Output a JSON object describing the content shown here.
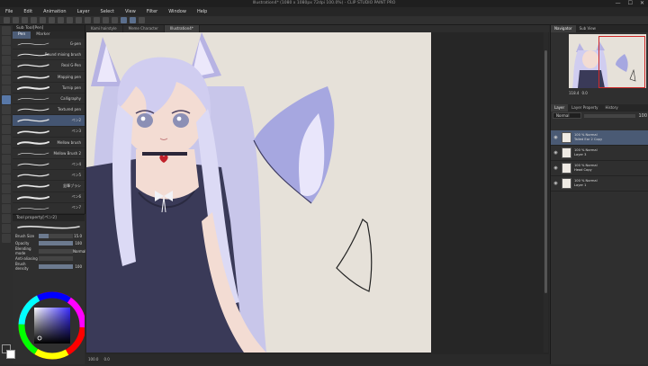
{
  "app": {
    "title": "Illustration4* (1080 x 1080px 72dpi 100.0%) - CLIP STUDIO PAINT PRO",
    "window_controls": [
      "—",
      "☐",
      "✕"
    ]
  },
  "menu": [
    "File",
    "Edit",
    "Animation",
    "Layer",
    "Select",
    "View",
    "Filter",
    "Window",
    "Help"
  ],
  "subtool": {
    "panel_title": "Sub Tool[Pen]",
    "tabs": [
      "Pen",
      "Marker"
    ],
    "brushes": [
      {
        "label": "G-pen"
      },
      {
        "label": "Round mixing brush"
      },
      {
        "label": "Real G-Pen"
      },
      {
        "label": "Mapping pen"
      },
      {
        "label": "Turnip pen"
      },
      {
        "label": "Calligraphy"
      },
      {
        "label": "Textured pen"
      },
      {
        "label": "ペン2"
      },
      {
        "label": "ペン3"
      },
      {
        "label": "Mellow brush"
      },
      {
        "label": "Mellow Brush 2"
      },
      {
        "label": "ペン4"
      },
      {
        "label": "ペン5"
      },
      {
        "label": "鉛筆ブラシ"
      },
      {
        "label": "ペン6"
      },
      {
        "label": "ペン7"
      },
      {
        "label": "ペン8"
      },
      {
        "label": "ペン9"
      }
    ],
    "active_index": 7
  },
  "tool_property": {
    "title": "Tool property[ペン2]",
    "rows": [
      {
        "key": "Brush Size",
        "value": "15.0",
        "fraction": 0.3
      },
      {
        "key": "Opacity",
        "value": "100",
        "fraction": 1.0
      },
      {
        "key": "Blending mode",
        "value": "Normal",
        "fraction": 0
      },
      {
        "key": "Anti-aliasing",
        "value": "",
        "fraction": 0
      },
      {
        "key": "Brush density",
        "value": "100",
        "fraction": 1.0
      }
    ]
  },
  "doc_tabs": [
    "Kami hairstyle",
    "Meme Character",
    "Illustration4*"
  ],
  "doc_tab_active": 2,
  "status": {
    "zoom": "100.0",
    "angle": "0.0"
  },
  "navigator": {
    "tabs": [
      "Navigator",
      "Sub View"
    ],
    "zoom": "118.4",
    "rotation": "0.0"
  },
  "layer_panel": {
    "tabs": [
      "Layer",
      "Layer Property",
      "History"
    ],
    "blend_mode": "Normal",
    "opacity": "100",
    "layers": [
      {
        "line1": "100 % Normal",
        "line2": "Tailed Ear 2 Copy",
        "active": true
      },
      {
        "line1": "100 % Normal",
        "line2": "Layer 3",
        "active": false
      },
      {
        "line1": "100 % Normal",
        "line2": "Head Copy",
        "active": false
      },
      {
        "line1": "100 % Normal",
        "line2": "Layer 1",
        "active": false
      }
    ]
  },
  "colors": {
    "accent": "#5878a8",
    "canvas_bg": "#e6e1d9",
    "hair": "#c8c6ea",
    "dress": "#3a3a58",
    "main_color": "#2b2b2b",
    "sub_color": "#ffffff"
  },
  "icons": {
    "eye": "eye-icon",
    "pen": "pen-icon"
  }
}
